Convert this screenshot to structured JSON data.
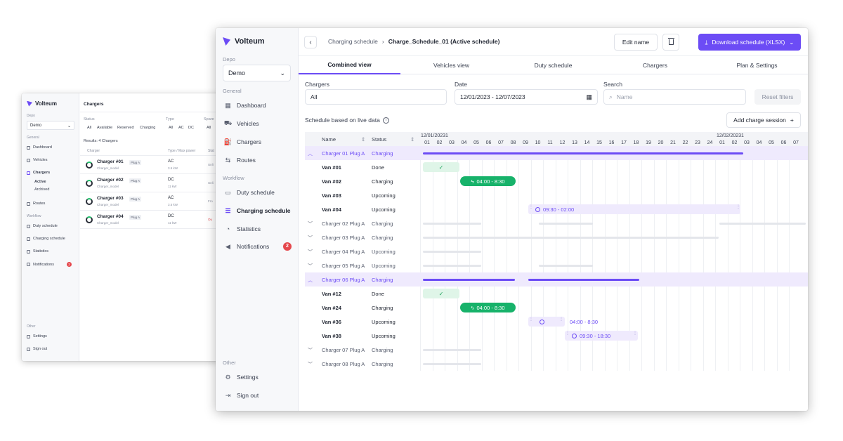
{
  "back_window": {
    "logo": "Volteum",
    "depo_label": "Depo",
    "depo_value": "Demo",
    "general_label": "General",
    "nav": [
      "Dashboard",
      "Vehicles",
      "Chargers",
      "Routes"
    ],
    "chargers_sub": [
      "Active",
      "Archived"
    ],
    "workflow_label": "Workflow",
    "workflow_nav": [
      "Duty schedule",
      "Charging schedule",
      "Statistics",
      "Notifications"
    ],
    "notif_count": "2",
    "other_label": "Other",
    "other_nav": [
      "Settings",
      "Sign out"
    ],
    "page_title": "Chargers",
    "filters": {
      "status_label": "Status",
      "status_chips": [
        "All",
        "Available",
        "Reserved",
        "Charging"
      ],
      "type_label": "Type",
      "type_chips": [
        "All",
        "AC",
        "DC"
      ],
      "spare_label": "Spare",
      "spare_chip": "All"
    },
    "results": "Results: 4 Chargers",
    "col_charger": "Charger",
    "col_type": "Type / Max power",
    "col_status": "Stat",
    "rows": [
      {
        "name": "Charger #01",
        "tag": "Plug A",
        "model": "Charger_model",
        "type": "AC",
        "power": "3.5 kW",
        "status": "Unli"
      },
      {
        "name": "Charger #02",
        "tag": "Plug A",
        "model": "Charger_model",
        "type": "DC",
        "power": "11 kW",
        "status": "Unli"
      },
      {
        "name": "Charger #03",
        "tag": "Plug A",
        "model": "Charger_model",
        "type": "AC",
        "power": "3.5 kW",
        "status": "Fro"
      },
      {
        "name": "Charger #04",
        "tag": "Plug A",
        "model": "Charger_model",
        "type": "DC",
        "power": "11 kW",
        "status": "Ou"
      }
    ]
  },
  "app": {
    "logo": "Volteum",
    "depo_label": "Depo",
    "depo_value": "Demo",
    "general_label": "General",
    "nav": [
      {
        "label": "Dashboard",
        "icon": "dashboard-icon"
      },
      {
        "label": "Vehicles",
        "icon": "vehicle-icon"
      },
      {
        "label": "Chargers",
        "icon": "charger-icon"
      },
      {
        "label": "Routes",
        "icon": "routes-icon"
      }
    ],
    "workflow_label": "Workflow",
    "workflow_nav": [
      {
        "label": "Duty schedule",
        "icon": "duty-icon"
      },
      {
        "label": "Charging schedule",
        "icon": "schedule-icon"
      },
      {
        "label": "Statistics",
        "icon": "statistics-icon"
      },
      {
        "label": "Notifications",
        "icon": "notification-icon"
      }
    ],
    "notif_count": "2",
    "other_label": "Other",
    "other_nav": [
      {
        "label": "Settings",
        "icon": "settings-icon"
      },
      {
        "label": "Sign out",
        "icon": "sign-out-icon"
      }
    ]
  },
  "header": {
    "crumb_parent": "Charging schedule",
    "crumb_current": "Charge_Schedule_01 (Active schedule)",
    "edit_label": "Edit name",
    "download_label": "Download schedule (XLSX)"
  },
  "tabs": [
    "Combined view",
    "Vehicles view",
    "Duty schedule",
    "Chargers",
    "Plan & Settings"
  ],
  "filters": {
    "chargers_label": "Chargers",
    "chargers_value": "All",
    "date_label": "Date",
    "date_value": "12/01/2023 - 12/07/2023",
    "search_label": "Search",
    "search_placeholder": "Name",
    "reset_label": "Reset filters"
  },
  "schedule_label": "Schedule based on live data",
  "add_session_label": "Add charge session",
  "table": {
    "col_name": "Name",
    "col_status": "Status",
    "date1": "12/01/20231",
    "date2": "12/02/20231",
    "hours": [
      "01",
      "02",
      "03",
      "04",
      "05",
      "06",
      "07",
      "08",
      "09",
      "10",
      "11",
      "12",
      "13",
      "14",
      "15",
      "16",
      "17",
      "18",
      "19",
      "20",
      "21",
      "22",
      "23",
      "24",
      "01",
      "02",
      "03",
      "04",
      "05",
      "06",
      "07"
    ],
    "rows": [
      {
        "name": "Charger 01 Plug A",
        "status": "Charging",
        "kind": "charger",
        "open": true
      },
      {
        "name": "Van #01",
        "status": "Done",
        "kind": "van"
      },
      {
        "name": "Van #02",
        "status": "Charging",
        "kind": "van"
      },
      {
        "name": "Van #03",
        "status": "Upcoming",
        "kind": "van"
      },
      {
        "name": "Van #04",
        "status": "Upcoming",
        "kind": "van"
      },
      {
        "name": "Charger 02 Plug A",
        "status": "Charging",
        "kind": "charger"
      },
      {
        "name": "Charger 03 Plug A",
        "status": "Charging",
        "kind": "charger"
      },
      {
        "name": "Charger 04 Plug A",
        "status": "Upcoming",
        "kind": "charger"
      },
      {
        "name": "Charger 05 Plug A",
        "status": "Upcoming",
        "kind": "charger"
      },
      {
        "name": "Charger 06 Plug A",
        "status": "Charging",
        "kind": "charger",
        "open": true
      },
      {
        "name": "Van #12",
        "status": "Done",
        "kind": "van"
      },
      {
        "name": "Van #24",
        "status": "Charging",
        "kind": "van"
      },
      {
        "name": "Van #36",
        "status": "Upcoming",
        "kind": "van"
      },
      {
        "name": "Van #38",
        "status": "Upcoming",
        "kind": "van"
      },
      {
        "name": "Charger 07 Plug A",
        "status": "Charging",
        "kind": "charger"
      },
      {
        "name": "Charger 08 Plug A",
        "status": "Charging",
        "kind": "charger"
      }
    ],
    "sessions": {
      "van02": "04:00 - 8:30",
      "van04": "09:30 - 02:00",
      "van24": "04:00 - 8:30",
      "van36": "04:00 - 8:30",
      "van38": "09:30 - 18:30"
    }
  },
  "colors": {
    "accent": "#6c4cf5",
    "success": "#17b26a",
    "danger": "#e5484d"
  }
}
